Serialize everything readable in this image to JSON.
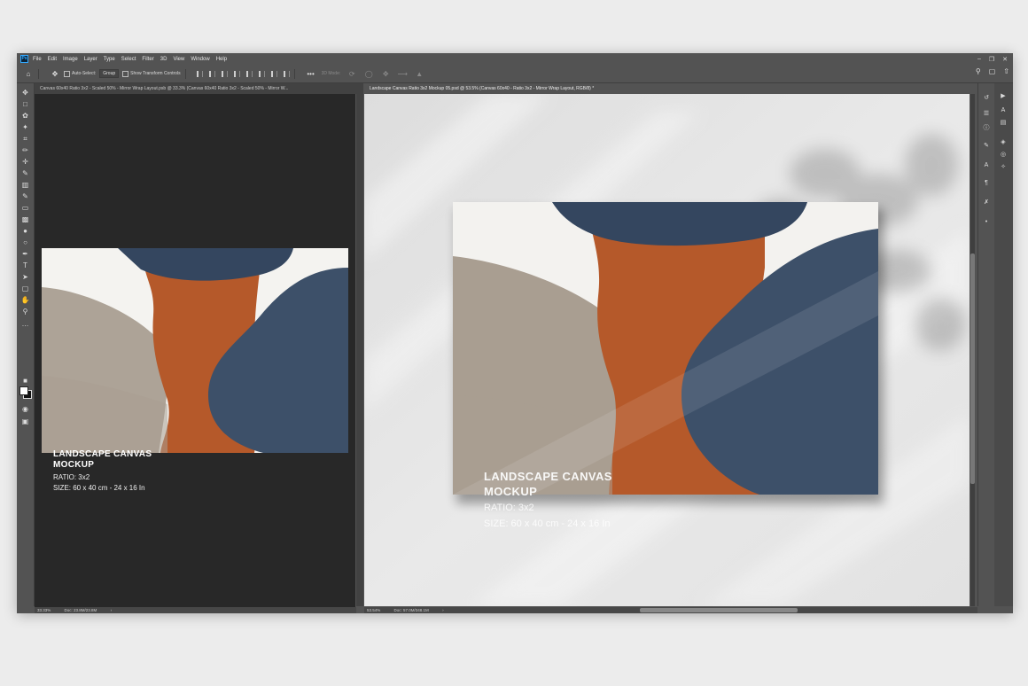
{
  "app": {
    "logo_text": "Ps",
    "menu": [
      "File",
      "Edit",
      "Image",
      "Layer",
      "Type",
      "Select",
      "Filter",
      "3D",
      "View",
      "Window",
      "Help"
    ]
  },
  "options_bar": {
    "auto_select_label": "Auto-Select:",
    "auto_select_value": "Group",
    "show_transform_label": "Show Transform Controls",
    "mode_3d_label": "3D Mode:"
  },
  "documents": {
    "left_tab": "Canvas 60x40 Ratio 3x2 - Scaled 50% - Mirror Wrap Layout.psb @ 33.3% (Canvas 60x40 Ratio 3x2 - Scaled 50% - Mirror W...",
    "right_tab": "Landscape Canvas Ratio 3x2 Mockup 05.psd @ 53.5% (Canvas 60x40 - Ratio 3x2 - Mirror Wrap Layout, RGB/8) *",
    "left_status": {
      "zoom": "33.33%",
      "doc": "Doc: 23.8M/23.8M"
    },
    "right_status": {
      "zoom": "53.54%",
      "doc": "Doc: 57.0M/348.1M"
    }
  },
  "artwork": {
    "title_line1": "LANDSCAPE CANVAS",
    "title_line2": "MOCKUP",
    "ratio": "RATIO: 3x2",
    "size": "SIZE: 60 x 40 cm - 24 x 16 In"
  },
  "colors": {
    "navy": "#34465f",
    "rust": "#b5592a",
    "taupe": "#a99e91",
    "canvas_white": "#f3f2ef",
    "wall": "#e6e6e6"
  }
}
